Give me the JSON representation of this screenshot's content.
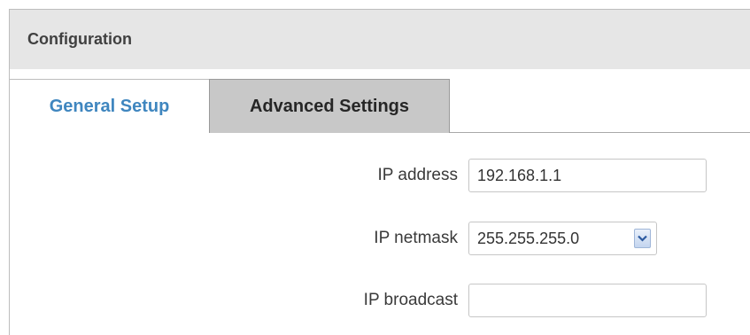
{
  "panel": {
    "title": "Configuration"
  },
  "tabs": [
    {
      "label": "General Setup",
      "active": true
    },
    {
      "label": "Advanced Settings",
      "active": false
    }
  ],
  "form": {
    "ip_address": {
      "label": "IP address",
      "value": "192.168.1.1"
    },
    "ip_netmask": {
      "label": "IP netmask",
      "value": "255.255.255.0"
    },
    "ip_broadcast": {
      "label": "IP broadcast",
      "value": ""
    }
  },
  "colors": {
    "active_tab_text": "#3f86bf",
    "header_bg": "#e6e6e6",
    "inactive_tab_bg": "#c8c8c8"
  },
  "icons": {
    "netmask_dropdown": "chevron-down-icon"
  }
}
